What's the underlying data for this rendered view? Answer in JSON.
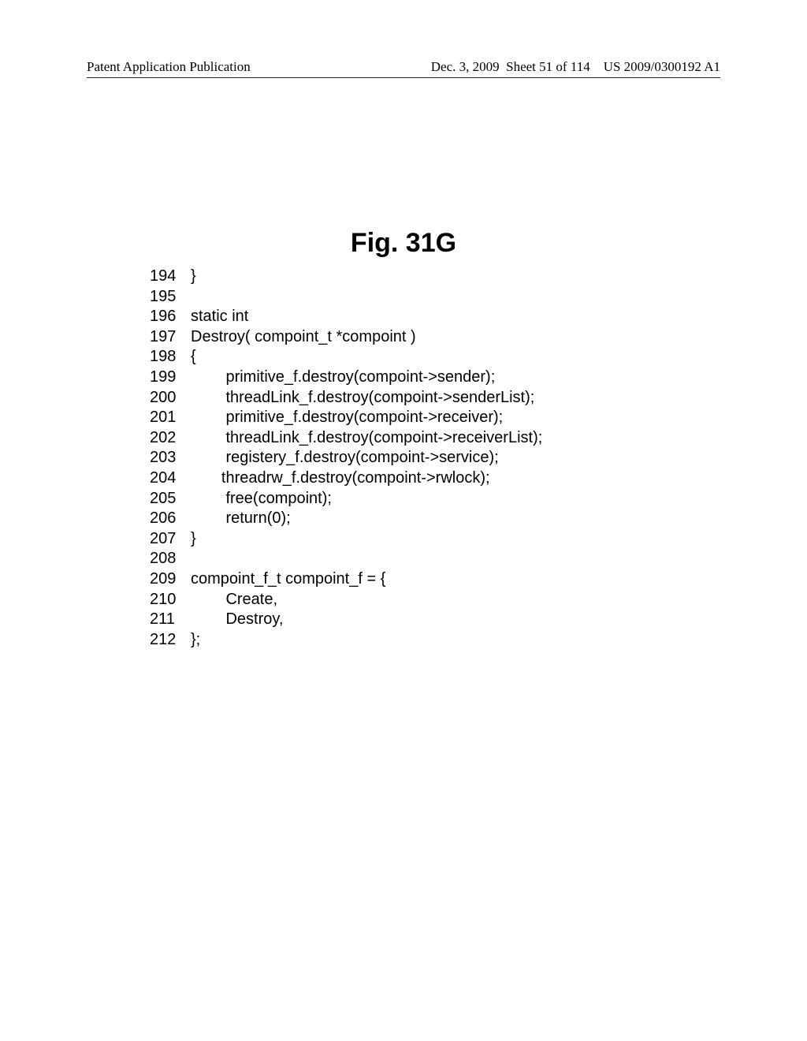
{
  "header": {
    "left": "Patent Application Publication",
    "date": "Dec. 3, 2009",
    "sheet": "Sheet 51 of 114",
    "pubno": "US 2009/0300192 A1"
  },
  "figure_title": "Fig. 31G",
  "code": [
    {
      "ln": "194",
      "text": "}"
    },
    {
      "ln": "195",
      "text": ""
    },
    {
      "ln": "196",
      "text": "static int"
    },
    {
      "ln": "197",
      "text": "Destroy( compoint_t *compoint )"
    },
    {
      "ln": "198",
      "text": "{"
    },
    {
      "ln": "199",
      "text": "        primitive_f.destroy(compoint->sender);"
    },
    {
      "ln": "200",
      "text": "        threadLink_f.destroy(compoint->senderList);"
    },
    {
      "ln": "201",
      "text": "        primitive_f.destroy(compoint->receiver);"
    },
    {
      "ln": "202",
      "text": "        threadLink_f.destroy(compoint->receiverList);"
    },
    {
      "ln": "203",
      "text": "        registery_f.destroy(compoint->service);"
    },
    {
      "ln": "204",
      "text": "       threadrw_f.destroy(compoint->rwlock);"
    },
    {
      "ln": "205",
      "text": "        free(compoint);"
    },
    {
      "ln": "206",
      "text": "        return(0);"
    },
    {
      "ln": "207",
      "text": "}"
    },
    {
      "ln": "208",
      "text": ""
    },
    {
      "ln": "209",
      "text": "compoint_f_t compoint_f = {"
    },
    {
      "ln": "210",
      "text": "        Create,"
    },
    {
      "ln": "211",
      "text": "        Destroy,"
    },
    {
      "ln": "212",
      "text": "};"
    }
  ]
}
